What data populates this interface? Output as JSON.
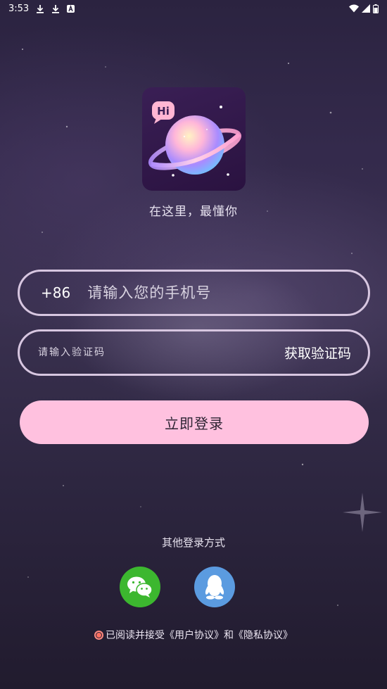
{
  "status_bar": {
    "time": "3:53",
    "icons": [
      "download-icon",
      "download-icon",
      "a-badge-icon",
      "wifi-icon",
      "signal-icon",
      "battery-icon"
    ]
  },
  "app": {
    "logo_text": "Hi",
    "slogan": "在这里，最懂你"
  },
  "form": {
    "country_code": "+86",
    "phone_placeholder": "请输入您的手机号",
    "code_placeholder": "请输入验证码",
    "get_code_label": "获取验证码",
    "login_label": "立即登录"
  },
  "other_login": {
    "label": "其他登录方式",
    "methods": [
      "wechat",
      "qq"
    ]
  },
  "agreement": {
    "prefix": "已阅读并接受",
    "user_agreement": "《用户协议》",
    "and": "和",
    "privacy_agreement": "《隐私协议》"
  },
  "colors": {
    "login_button": "#ffc1df",
    "wechat": "#3cb72f",
    "qq": "#5b9be0",
    "field_border": "#d7c6e0",
    "radio": "#ff6f61"
  }
}
